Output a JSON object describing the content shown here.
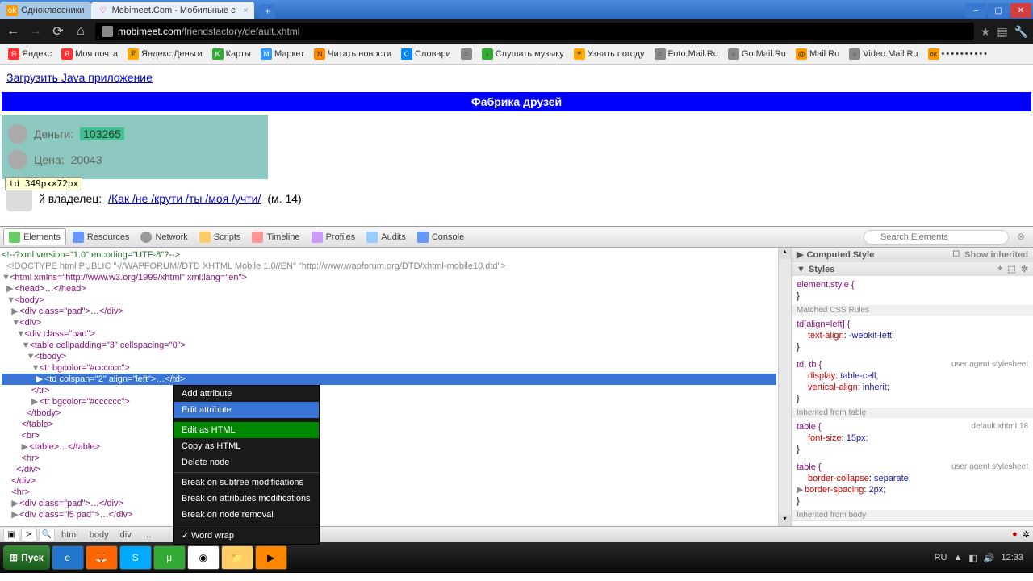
{
  "window": {
    "tabs": [
      {
        "title": "Одноклассники",
        "active": false
      },
      {
        "title": "Mobimeet.Com - Мобильные с",
        "active": true
      }
    ],
    "controls": {
      "min": "–",
      "max": "▢",
      "close": "✕"
    }
  },
  "toolbar": {
    "url_domain": "mobimeet.com",
    "url_path": "/friendsfactory/default.xhtml"
  },
  "bookmarks": [
    "Яндекс",
    "Моя почта",
    "Яндекс.Деньги",
    "Карты",
    "Маркет",
    "Читать новости",
    "Словари",
    "",
    "Слушать музыку",
    "Узнать погоду",
    "Foto.Mail.Ru",
    "Go.Mail.Ru",
    "Mail.Ru",
    "Video.Mail.Ru",
    ""
  ],
  "page": {
    "top_link": "Загрузить Java приложение",
    "banner": "Фабрика друзей",
    "money_label": "Деньги:",
    "money_value": "103265",
    "price_label": "Цена:",
    "price_value": "20043",
    "tooltip": "td 349px×72px",
    "owner_label": "й владелец:",
    "owner_link": "/Как /не /крути /ты /моя /учти/",
    "owner_suffix": "(м. 14)"
  },
  "devtools": {
    "tabs": [
      "Elements",
      "Resources",
      "Network",
      "Scripts",
      "Timeline",
      "Profiles",
      "Audits",
      "Console"
    ],
    "search_placeholder": "Search Elements",
    "tree": {
      "l1": "<!--?xml version=\"1.0\" encoding=\"UTF-8\"?-->",
      "l2": "<!DOCTYPE html PUBLIC \"-//WAPFORUM//DTD XHTML Mobile 1.0//EN\" \"http://www.wapforum.org/DTD/xhtml-mobile10.dtd\">",
      "l3": "<html xmlns=\"http://www.w3.org/1999/xhtml\" xml:lang=\"en\">",
      "l4": "<head>…</head>",
      "l5": "<body>",
      "l6": "<div class=\"pad\">…</div>",
      "l7": "<div>",
      "l8": "<div class=\"pad\">",
      "l9": "<table cellpadding=\"3\" cellspacing=\"0\">",
      "l10": "<tbody>",
      "l11": "<tr bgcolor=\"#cccccc\">",
      "l12": "<td colspan=\"2\" align=\"left\">…</td>",
      "l13": "</tr>",
      "l14": "<tr bgcolor=\"#cccccc\">                        …</tr>",
      "l15": "</tbody>",
      "l16": "</table>",
      "l17": "<br>",
      "l18": "<table>…</table>",
      "l19": "<hr>",
      "l20": "</div>",
      "l21": "</div>",
      "l22": "<hr>",
      "l23": "<div class=\"pad\">…</div>",
      "l24": "<div class=\"l5 pad\">…</div>"
    },
    "context_menu": {
      "add_attr": "Add attribute",
      "edit_attr": "Edit attribute",
      "edit_html": "Edit as HTML",
      "copy_html": "Copy as HTML",
      "delete": "Delete node",
      "break_subtree": "Break on subtree modifications",
      "break_attr": "Break on attributes modifications",
      "break_removal": "Break on node removal",
      "word_wrap": "Word wrap"
    },
    "breadcrumbs": [
      "html",
      "body",
      "div",
      "…"
    ],
    "styles": {
      "computed": "Computed Style",
      "show_inherited": "Show inherited",
      "styles_header": "Styles",
      "element_style": "element.style {",
      "matched": "Matched CSS Rules",
      "rule1_sel": "td[align=left] {",
      "rule1_prop": "text-align",
      "rule1_val": "-webkit-left;",
      "rule2_sel": "td, th {",
      "rule2_src": "user agent stylesheet",
      "rule2_p1": "display",
      "rule2_v1": "table-cell;",
      "rule2_p2": "vertical-align",
      "rule2_v2": "inherit;",
      "inherit_table": "Inherited from table",
      "rule3_sel": "table {",
      "rule3_src": "default.xhtml:18",
      "rule3_p1": "font-size",
      "rule3_v1": "15px;",
      "rule4_sel": "table {",
      "rule4_src": "user agent stylesheet",
      "rule4_p1": "border-collapse",
      "rule4_v1": "separate;",
      "rule4_p2": "border-spacing",
      "rule4_v2": "2px;",
      "inherit_body": "Inherited from body"
    }
  },
  "taskbar": {
    "start": "Пуск",
    "lang": "RU",
    "time": "12:33"
  }
}
